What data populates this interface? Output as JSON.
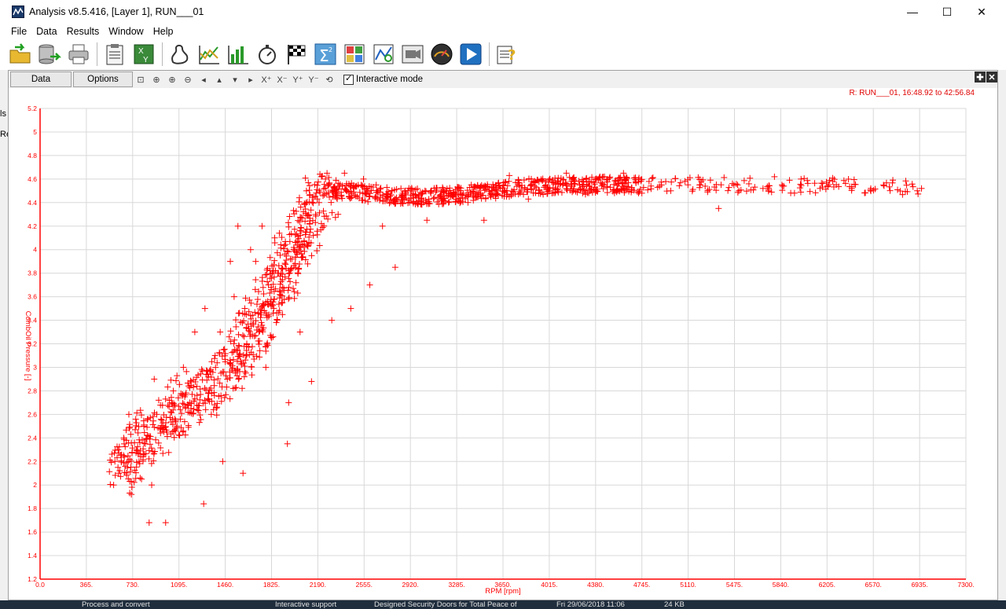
{
  "window": {
    "title": "Analysis v8.5.416, [Layer 1], RUN___01",
    "minimize": "—",
    "maximize": "☐",
    "close": "✕"
  },
  "menu": {
    "file": "File",
    "data": "Data",
    "results": "Results",
    "window": "Window",
    "help": "Help"
  },
  "toolbar_icons": [
    "open-folder-icon",
    "database-export-icon",
    "print-icon",
    "clipboard-icon",
    "xy-plot-icon",
    "track-map-icon",
    "line-chart-icon",
    "bar-chart-icon",
    "stopwatch-icon",
    "checkered-flag-icon",
    "sigma-math-icon",
    "calculator-grid-icon",
    "histogram-fit-icon",
    "video-camera-icon",
    "gauge-icon",
    "play-icon",
    "help-icon"
  ],
  "child": {
    "tab_data": "Data",
    "tab_options": "Options",
    "interactive_label": "Interactive mode",
    "interactive_checked": true,
    "run_label": "R: RUN___01, 16:48.92 to 42:56.84"
  },
  "left_panel": {
    "text1": "ls",
    "text2": "Re"
  },
  "taskbar": {
    "item1": "Process and convert",
    "item2": "Interactive support",
    "item3": "Designed Security Doors for Total Peace of",
    "item4": "Fri 29/06/2018 11:06",
    "item5": "24 KB"
  },
  "chart_data": {
    "type": "scatter",
    "xlabel": "RPM [rpm]",
    "ylabel": "CombOil Pressure [-]",
    "xlim": [
      0,
      7300
    ],
    "ylim": [
      1.2,
      5.2
    ],
    "xticks": [
      "0.0",
      "365.",
      "730.",
      "1095.",
      "1460.",
      "1825.",
      "2190.",
      "2555.",
      "2920.",
      "3285.",
      "3650.",
      "4015.",
      "4380.",
      "4745.",
      "5110.",
      "5475.",
      "5840.",
      "6205.",
      "6570.",
      "6935.",
      "7300."
    ],
    "yticks": [
      "1.2",
      "1.4",
      "1.6",
      "1.8",
      "2",
      "2.2",
      "2.4",
      "2.6",
      "2.8",
      "3",
      "3.2",
      "3.4",
      "3.6",
      "3.8",
      "4",
      "4.2",
      "4.4",
      "4.6",
      "4.8",
      "5",
      "5.2"
    ],
    "color": "#ff0000",
    "grid": true,
    "marker": "+",
    "trend": [
      [
        600,
        2.1
      ],
      [
        730,
        2.25
      ],
      [
        850,
        2.4
      ],
      [
        1000,
        2.55
      ],
      [
        1150,
        2.7
      ],
      [
        1300,
        2.8
      ],
      [
        1460,
        2.95
      ],
      [
        1600,
        3.15
      ],
      [
        1700,
        3.35
      ],
      [
        1825,
        3.6
      ],
      [
        1950,
        3.85
      ],
      [
        2050,
        4.1
      ],
      [
        2150,
        4.35
      ],
      [
        2250,
        4.5
      ],
      [
        2400,
        4.5
      ],
      [
        2600,
        4.47
      ],
      [
        3000,
        4.45
      ],
      [
        3400,
        4.47
      ],
      [
        3800,
        4.53
      ],
      [
        4200,
        4.55
      ],
      [
        4745,
        4.55
      ],
      [
        5200,
        4.55
      ],
      [
        6000,
        4.55
      ],
      [
        6950,
        4.53
      ]
    ],
    "points": [
      [
        580,
        2.0
      ],
      [
        590,
        2.2
      ],
      [
        620,
        2.1
      ],
      [
        660,
        2.4
      ],
      [
        700,
        2.6
      ],
      [
        720,
        1.92
      ],
      [
        760,
        2.3
      ],
      [
        780,
        2.2
      ],
      [
        800,
        2.05
      ],
      [
        830,
        2.35
      ],
      [
        860,
        1.68
      ],
      [
        880,
        2.0
      ],
      [
        900,
        2.9
      ],
      [
        920,
        2.6
      ],
      [
        990,
        1.68
      ],
      [
        1000,
        2.45
      ],
      [
        1050,
        2.8
      ],
      [
        1080,
        2.5
      ],
      [
        1130,
        3.0
      ],
      [
        1180,
        2.7
      ],
      [
        1220,
        3.3
      ],
      [
        1290,
        1.84
      ],
      [
        1300,
        3.5
      ],
      [
        1350,
        2.6
      ],
      [
        1380,
        3.1
      ],
      [
        1420,
        3.3
      ],
      [
        1440,
        2.2
      ],
      [
        1500,
        3.9
      ],
      [
        1530,
        3.6
      ],
      [
        1560,
        4.2
      ],
      [
        1600,
        2.1
      ],
      [
        1630,
        3.2
      ],
      [
        1660,
        4.0
      ],
      [
        1700,
        3.9
      ],
      [
        1750,
        4.2
      ],
      [
        1780,
        3.0
      ],
      [
        1800,
        3.7
      ],
      [
        1850,
        4.1
      ],
      [
        1900,
        3.8
      ],
      [
        1950,
        2.35
      ],
      [
        1960,
        2.7
      ],
      [
        2000,
        4.0
      ],
      [
        2050,
        3.3
      ],
      [
        2100,
        4.5
      ],
      [
        2140,
        2.88
      ],
      [
        2200,
        4.4
      ],
      [
        2250,
        4.6
      ],
      [
        2300,
        3.4
      ],
      [
        2350,
        4.3
      ],
      [
        2400,
        4.65
      ],
      [
        2450,
        3.5
      ],
      [
        2500,
        4.45
      ],
      [
        2550,
        4.6
      ],
      [
        2600,
        3.7
      ],
      [
        2650,
        4.55
      ],
      [
        2700,
        4.2
      ],
      [
        2800,
        3.85
      ],
      [
        2900,
        4.5
      ],
      [
        3050,
        4.25
      ],
      [
        3200,
        4.5
      ],
      [
        3400,
        4.55
      ],
      [
        3500,
        4.25
      ],
      [
        3600,
        4.5
      ],
      [
        3700,
        4.63
      ],
      [
        3850,
        4.43
      ],
      [
        4000,
        4.53
      ],
      [
        4150,
        4.65
      ],
      [
        4300,
        4.47
      ],
      [
        4450,
        4.62
      ],
      [
        4600,
        4.65
      ],
      [
        4745,
        4.48
      ],
      [
        4900,
        4.55
      ],
      [
        5050,
        4.57
      ],
      [
        5200,
        4.55
      ],
      [
        5350,
        4.35
      ],
      [
        5500,
        4.55
      ],
      [
        5700,
        4.52
      ],
      [
        5850,
        4.55
      ],
      [
        6000,
        4.6
      ],
      [
        6150,
        4.52
      ],
      [
        6250,
        4.58
      ],
      [
        6400,
        4.52
      ],
      [
        6550,
        4.52
      ],
      [
        6650,
        4.55
      ],
      [
        6950,
        4.52
      ]
    ]
  }
}
